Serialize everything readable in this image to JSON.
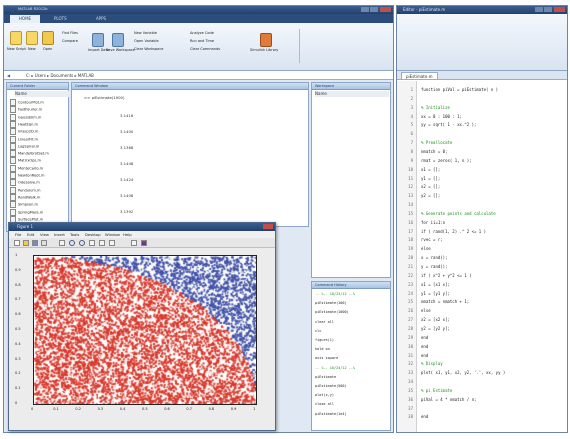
{
  "matlab_window": {
    "title": "MATLAB R2012b",
    "tabs": [
      "HOME",
      "PLOTS",
      "APPS"
    ],
    "toolstrip": {
      "new_script": "New Script",
      "new": "New",
      "open": "Open",
      "find_files": "Find Files",
      "compare": "Compare",
      "import_data": "Import Data",
      "save_workspace": "Save Workspace",
      "new_variable": "New Variable",
      "open_variable": "Open Variable",
      "clear_workspace": "Clear Workspace",
      "analyze_code": "Analyze Code",
      "run_and_time": "Run and Time",
      "clear_commands": "Clear Commands",
      "simulink": "Simulink Library"
    },
    "path_bar": "C: ▸ Users ▸ Documents ▸ MATLAB",
    "current_folder": {
      "title": "Current Folder",
      "header": "Name",
      "files": [
        "ContourPlot.m",
        "FastFourier.m",
        "GaussElim.m",
        "HeatEqn.m",
        "Interp2D.m",
        "LinearFit.m",
        "LogSpiral.m",
        "MandelbrotSet.m",
        "MatrixOps.m",
        "MonteCarlo.m",
        "NewtonRoot.m",
        "OdeSolve.m",
        "Pendulum.m",
        "RandWalk.m",
        "Simpson.m",
        "SpringMass.m",
        "SurfacePlot.m",
        "WaveEqn.m"
      ]
    },
    "command_window": {
      "title": "Command Window",
      "prompt": ">> piEstimate(1000)",
      "values": [
        "3.1416",
        "3.1400",
        "3.1368",
        "3.1448",
        "3.1424",
        "3.1408",
        "3.1392",
        "3.1432"
      ]
    },
    "workspace": {
      "title": "Workspace",
      "header": "Name"
    },
    "command_history": {
      "title": "Command History",
      "lines": [
        "-- %-- 10/23/12 --%",
        "piEstimate(100)",
        "piEstimate(1000)",
        "clear all",
        "clc",
        "figure(1)",
        "hold on",
        "axis square",
        "-- %-- 10/24/12 --%",
        "piEstimate",
        "piEstimate(500)",
        "plot(x,y)",
        "close all",
        "piEstimate(1e4)"
      ]
    }
  },
  "figure_window": {
    "title": "Figure 1",
    "menu": [
      "File",
      "Edit",
      "View",
      "Insert",
      "Tools",
      "Desktop",
      "Window",
      "Help"
    ],
    "x_ticks": [
      "0",
      "0.1",
      "0.2",
      "0.3",
      "0.4",
      "0.5",
      "0.6",
      "0.7",
      "0.8",
      "0.9",
      "1"
    ],
    "y_ticks": [
      "1",
      "0.9",
      "0.8",
      "0.7",
      "0.6",
      "0.5",
      "0.4",
      "0.3",
      "0.2",
      "0.1",
      "0"
    ],
    "colors": {
      "inside": "#d8392c",
      "outside": "#4252a8",
      "speckle": "#ffffff"
    }
  },
  "editor": {
    "title": "Editor - piEstimate.m",
    "tab": "piEstimate.m",
    "lines": [
      {
        "n": "1",
        "text": "function piVal = piEstimate( n )",
        "comment": false
      },
      {
        "n": "2",
        "text": "",
        "comment": false
      },
      {
        "n": "3",
        "text": "  % Initialize",
        "comment": true
      },
      {
        "n": "4",
        "text": "  xx = 0 : 100 : 1;",
        "comment": false
      },
      {
        "n": "5",
        "text": "  yy = sqrt( 1 - xx.^2 );",
        "comment": false
      },
      {
        "n": "6",
        "text": "",
        "comment": false
      },
      {
        "n": "7",
        "text": "  % Preallocate",
        "comment": true
      },
      {
        "n": "8",
        "text": "  nmatch = 0;",
        "comment": false
      },
      {
        "n": "9",
        "text": "  rmat = zeros( 1, n );",
        "comment": false
      },
      {
        "n": "10",
        "text": "  x1 = [];",
        "comment": false
      },
      {
        "n": "11",
        "text": "  y1 = [];",
        "comment": false
      },
      {
        "n": "12",
        "text": "  x2 = [];",
        "comment": false
      },
      {
        "n": "13",
        "text": "  y2 = [];",
        "comment": false
      },
      {
        "n": "14",
        "text": "",
        "comment": false
      },
      {
        "n": "15",
        "text": "  % Generate points and calculate",
        "comment": true
      },
      {
        "n": "16",
        "text": "  for ii=1:n",
        "comment": false
      },
      {
        "n": "17",
        "text": "      if ( rand(1, 2) .^ 2 <= 1 )",
        "comment": false
      },
      {
        "n": "18",
        "text": "        rvec = r;",
        "comment": false
      },
      {
        "n": "19",
        "text": "      else",
        "comment": false
      },
      {
        "n": "20",
        "text": "        x = rand();",
        "comment": false
      },
      {
        "n": "21",
        "text": "        y = rand();",
        "comment": false
      },
      {
        "n": "22",
        "text": "        if ( x^2 + y^2 <= 1 )",
        "comment": false
      },
      {
        "n": "23",
        "text": "          x1 = [x1 x];",
        "comment": false
      },
      {
        "n": "24",
        "text": "          y1 = [y1 y];",
        "comment": false
      },
      {
        "n": "25",
        "text": "          nmatch = nmatch + 1;",
        "comment": false
      },
      {
        "n": "26",
        "text": "        else",
        "comment": false
      },
      {
        "n": "27",
        "text": "          x2 = [x2 x];",
        "comment": false
      },
      {
        "n": "28",
        "text": "          y2 = [y2 y];",
        "comment": false
      },
      {
        "n": "29",
        "text": "        end",
        "comment": false
      },
      {
        "n": "30",
        "text": "      end",
        "comment": false
      },
      {
        "n": "31",
        "text": "  end",
        "comment": false
      },
      {
        "n": "32",
        "text": "  % Display",
        "comment": true
      },
      {
        "n": "33",
        "text": "  plot( x1, y1, x2, y2, '.', xx, yy )",
        "comment": false
      },
      {
        "n": "34",
        "text": "",
        "comment": false
      },
      {
        "n": "35",
        "text": "  % pi Estimate",
        "comment": true
      },
      {
        "n": "36",
        "text": "  piVal = 4 * nmatch / n;",
        "comment": false
      },
      {
        "n": "37",
        "text": "",
        "comment": false
      },
      {
        "n": "38",
        "text": "end",
        "comment": false
      }
    ]
  }
}
